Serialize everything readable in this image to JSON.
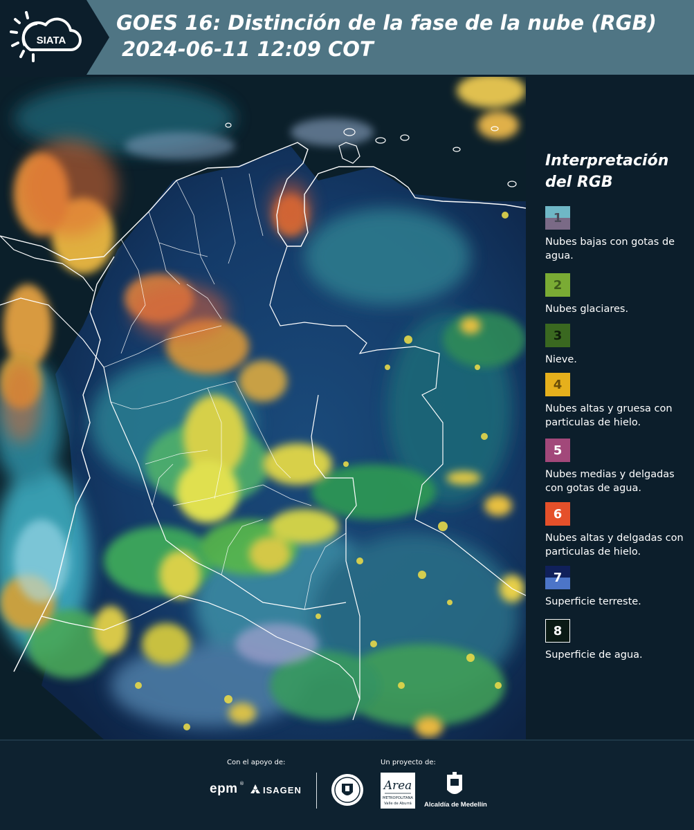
{
  "header": {
    "title_line1": "GOES 16: Distinción de la fase de la nube (RGB)",
    "title_line2": "2024-06-11 12:09 COT",
    "logo_text": "SIATA"
  },
  "legend": {
    "title_line1": "Interpretación",
    "title_line2": "del RGB",
    "items": [
      {
        "num": "1",
        "label": "Nubes bajas con gotas de agua.",
        "color_top": "#6fb7c6",
        "color_bottom": "#7a6a86"
      },
      {
        "num": "2",
        "label": "Nubes glaciares.",
        "color_top": "#7aab34",
        "color_bottom": "#7aab34"
      },
      {
        "num": "3",
        "label": "Nieve.",
        "color_top": "#3a6820",
        "color_bottom": "#3a6820"
      },
      {
        "num": "4",
        "label": "Nubes altas y gruesa con particulas de hielo.",
        "color_top": "#e6b01c",
        "color_bottom": "#e6b01c"
      },
      {
        "num": "5",
        "label": "Nubes medias y delgadas con gotas de agua.",
        "color_top": "#a2487a",
        "color_bottom": "#a2487a"
      },
      {
        "num": "6",
        "label": "Nubes altas y delgadas con particulas de hielo.",
        "color_top": "#e5502a",
        "color_bottom": "#e5502a"
      },
      {
        "num": "7",
        "label": "Superficie terreste.",
        "color_top": "#10205a",
        "color_bottom": "#4c75c8"
      },
      {
        "num": "8",
        "label": "Superficie de agua.",
        "color_top": "#0a1a14",
        "color_bottom": "#0a1a14"
      }
    ]
  },
  "footer": {
    "support_label": "Con el apoyo de:",
    "project_label": "Un proyecto de:",
    "sponsor_epm": "epm",
    "sponsor_isagen": "ISAGEN",
    "partner_area": "Area",
    "partner_area_sub1": "METROPOLITANA",
    "partner_area_sub2": "Valle de Aburrá",
    "partner_alcaldia": "Alcaldía de Medellín"
  },
  "colors": {
    "header_band": "#4f7584",
    "background": "#0c1e2b"
  }
}
